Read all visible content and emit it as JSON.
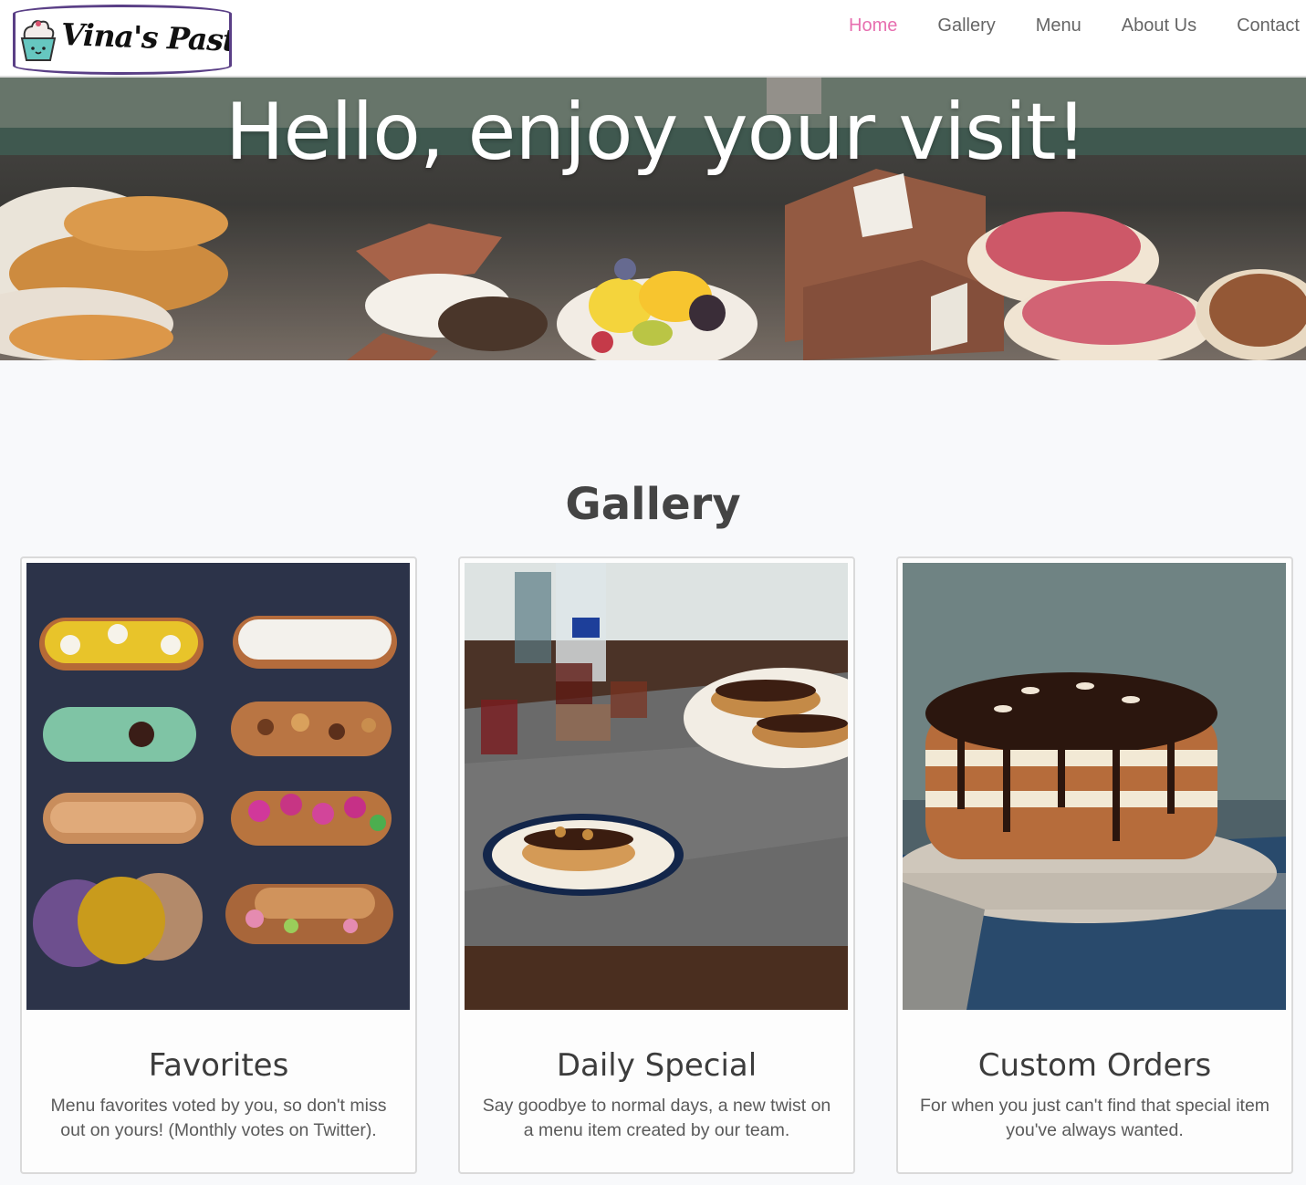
{
  "brand": {
    "logo_text": "Vina's Pastry"
  },
  "nav": {
    "items": [
      {
        "label": "Home",
        "active": true
      },
      {
        "label": "Gallery",
        "active": false
      },
      {
        "label": "Menu",
        "active": false
      },
      {
        "label": "About Us",
        "active": false
      },
      {
        "label": "Contact",
        "active": false
      }
    ]
  },
  "hero": {
    "title": "Hello, enjoy your visit!"
  },
  "gallery": {
    "heading": "Gallery",
    "cards": [
      {
        "title": "Favorites",
        "text": "Menu favorites voted by you, so don't miss out on yours! (Monthly votes on Twitter)."
      },
      {
        "title": "Daily Special",
        "text": "Say goodbye to normal days, a new twist on a menu item created by our team."
      },
      {
        "title": "Custom Orders",
        "text": "For when you just can't find that special item you've always wanted."
      }
    ]
  },
  "colors": {
    "nav_active": "#e76fb0",
    "nav_text": "#666666",
    "logo_border": "#5a3f86",
    "heading": "#444444"
  }
}
